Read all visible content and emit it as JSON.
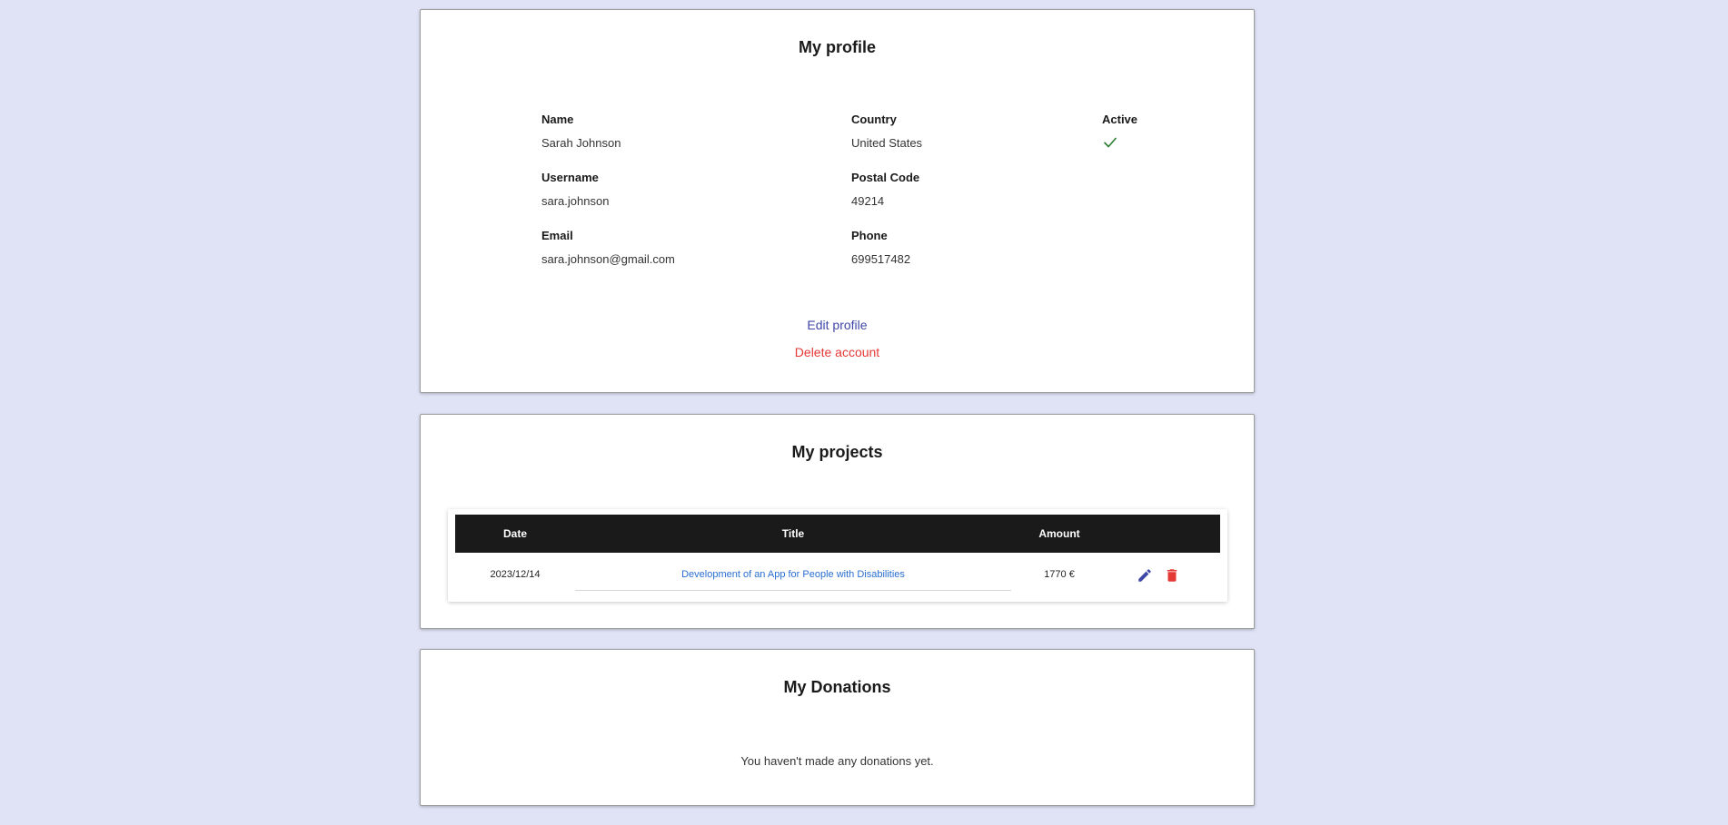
{
  "profile": {
    "title": "My profile",
    "fields": {
      "name": {
        "label": "Name",
        "value": "Sarah Johnson"
      },
      "username": {
        "label": "Username",
        "value": "sara.johnson"
      },
      "email": {
        "label": "Email",
        "value": "sara.johnson@gmail.com"
      },
      "country": {
        "label": "Country",
        "value": "United States"
      },
      "postal_code": {
        "label": "Postal Code",
        "value": "49214"
      },
      "phone": {
        "label": "Phone",
        "value": "699517482"
      },
      "active": {
        "label": "Active",
        "icon": "check-icon",
        "color": "#2e7d32"
      }
    },
    "edit_label": "Edit profile",
    "delete_label": "Delete account"
  },
  "projects": {
    "title": "My projects",
    "columns": [
      "Date",
      "Title",
      "Amount"
    ],
    "rows": [
      {
        "date": "2023/12/14",
        "title": "Development of an App for People with Disabilities",
        "amount": "1770 €",
        "actions": [
          "pencil-icon",
          "trash-icon"
        ]
      }
    ]
  },
  "donations": {
    "title": "My Donations",
    "empty_message": "You haven't made any donations yet."
  },
  "colors": {
    "background": "#dfe3f5",
    "accent": "#3f47a8",
    "danger": "#e53935",
    "link": "#2a6fd1",
    "table_header": "#1a1a1a",
    "success": "#2e7d32"
  }
}
